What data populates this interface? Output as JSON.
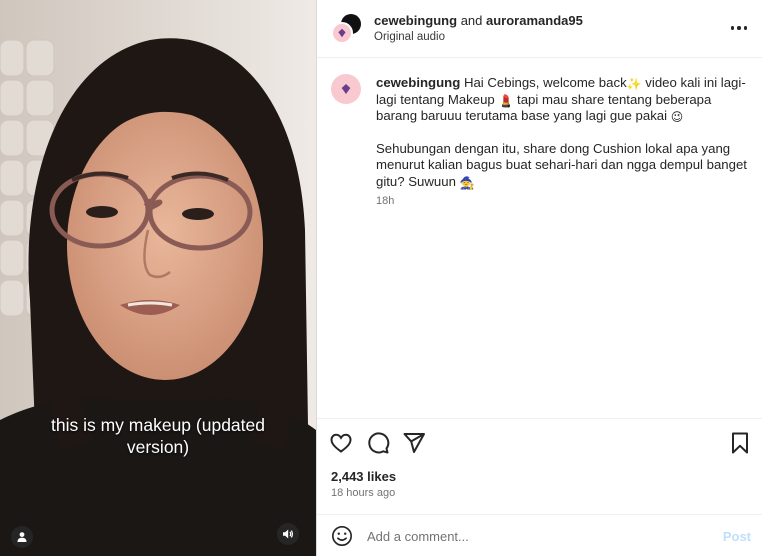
{
  "video": {
    "caption_line1": "this is my makeup (updated",
    "caption_line2": "version)",
    "icons": {
      "user_tag": "person-icon",
      "mute": "speaker-icon"
    }
  },
  "header": {
    "username": "cewebingung",
    "joiner": "and",
    "collaborator": "auroramanda95",
    "audio": "Original audio",
    "more_icon": "more-horizontal-icon"
  },
  "post_caption": {
    "username": "cewebingung",
    "p1_part1": "Hai Cebings, welcome back",
    "p1_emoji1": "✨",
    "p1_part2": " video kali ini lagi-lagi tentang Makeup ",
    "p1_emoji2": "💄",
    "p1_part3": " tapi mau share tentang beberapa barang baruuu terutama base yang lagi gue pakai ",
    "p1_emoji3": "😉",
    "p2_text": "Sehubungan dengan itu, share dong Cushion lokal apa yang menurut kalian bagus buat sehari-hari dan ngga dempul banget gitu? Suwuun ",
    "p2_emoji": "🧙",
    "timestamp": "18h"
  },
  "actions": {
    "icons": [
      "heart-icon",
      "comment-icon",
      "share-icon",
      "bookmark-icon"
    ]
  },
  "stats": {
    "likes": "2,443 likes",
    "posted_ago": "18 hours ago"
  },
  "comment_bar": {
    "placeholder": "Add a comment...",
    "post_label": "Post",
    "emoji_icon": "smiley-icon"
  },
  "colors": {
    "border": "#dbdbdb",
    "secondary_text": "#737373",
    "post_button_disabled": "#c0dffd",
    "avatar_pink": "#f8c9cf"
  }
}
